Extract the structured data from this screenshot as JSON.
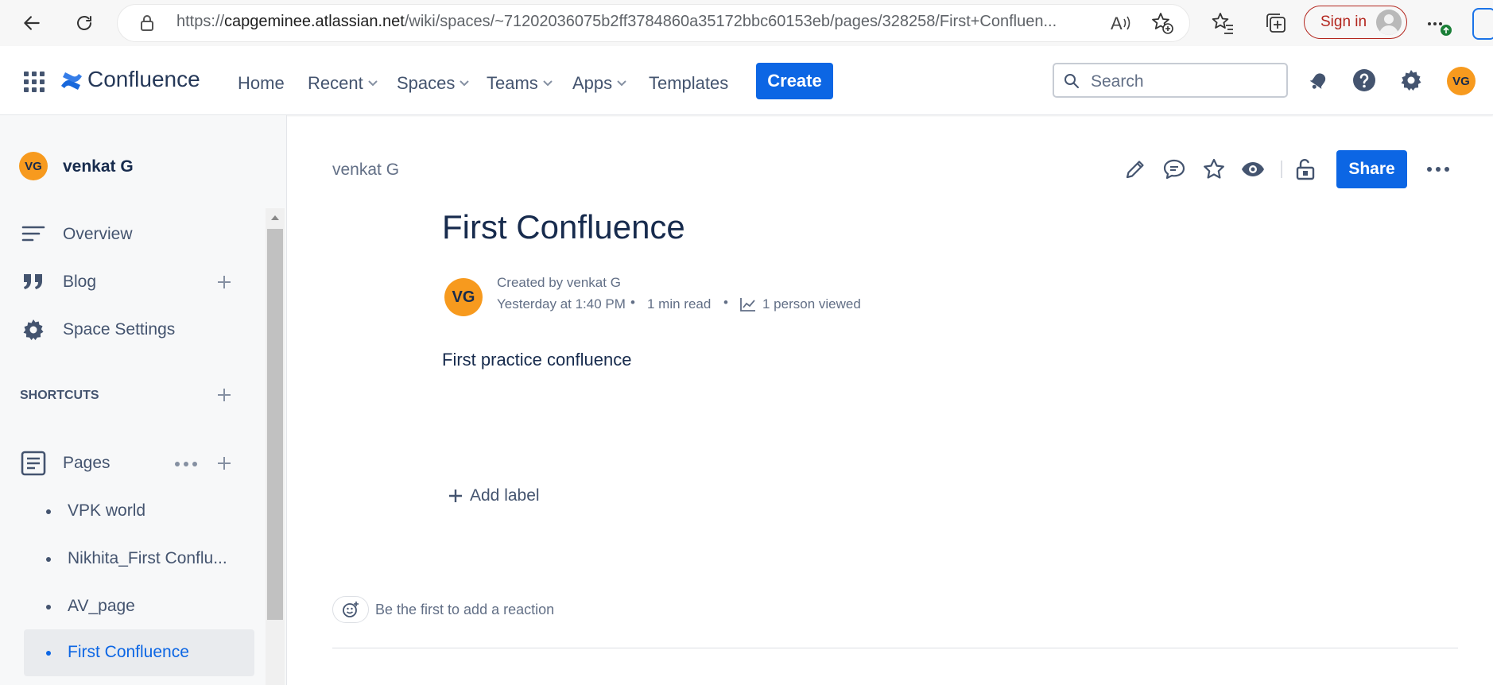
{
  "browser": {
    "url_prefix": "https://",
    "url_host": "capgeminee.atlassian.net",
    "url_path": "/wiki/spaces/~71202036075b2ff3784860a35172bbc60153eb/pages/328258/First+Confluen...",
    "sign_in_label": "Sign in"
  },
  "header": {
    "product_name": "Confluence",
    "nav": [
      {
        "label": "Home",
        "has_dropdown": false
      },
      {
        "label": "Recent",
        "has_dropdown": true
      },
      {
        "label": "Spaces",
        "has_dropdown": true
      },
      {
        "label": "Teams",
        "has_dropdown": true
      },
      {
        "label": "Apps",
        "has_dropdown": true
      },
      {
        "label": "Templates",
        "has_dropdown": false
      }
    ],
    "create_label": "Create",
    "search_placeholder": "Search",
    "user_initials": "VG"
  },
  "sidebar": {
    "space_initials": "VG",
    "space_name": "venkat G",
    "items": [
      {
        "label": "Overview",
        "icon": "overview-icon"
      },
      {
        "label": "Blog",
        "icon": "quote-icon"
      },
      {
        "label": "Space Settings",
        "icon": "gear-icon"
      }
    ],
    "shortcuts_label": "SHORTCUTS",
    "pages_label": "Pages",
    "pages": [
      {
        "title": "VPK world",
        "selected": false
      },
      {
        "title": "Nikhita_First Conflu...",
        "selected": false
      },
      {
        "title": "AV_page",
        "selected": false
      },
      {
        "title": "First Confluence",
        "selected": true
      }
    ]
  },
  "page": {
    "breadcrumb": "venkat G",
    "title": "First Confluence",
    "author_initials": "VG",
    "created_by": "Created by venkat G",
    "created_at": "Yesterday at 1:40 PM",
    "read_time": "1 min read",
    "views": "1 person viewed",
    "body": "First practice confluence",
    "add_label": "Add label",
    "reaction_prompt": "Be the first to add a reaction",
    "share_label": "Share"
  },
  "colors": {
    "brand_blue": "#0c66e4",
    "avatar_orange": "#f79a1e",
    "selected_link": "#0c66e4",
    "selected_row_bg": "#e9ebee"
  }
}
